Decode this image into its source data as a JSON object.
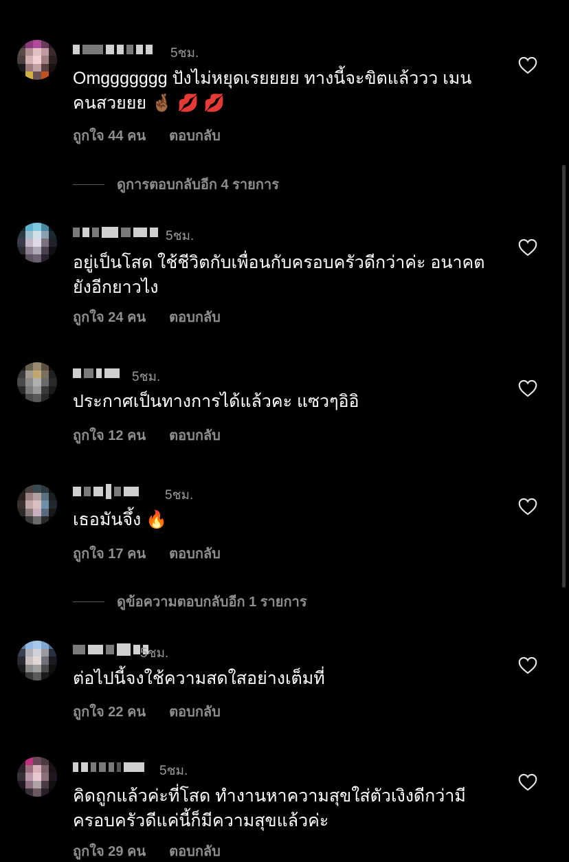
{
  "comments": [
    {
      "time": "5ชม.",
      "text": "Omggggggg ปังไม่หยุดเรยยยย ทางนี้จะขิตแล้ววว เมน คนสวยยย 🤞🏾 💋 💋",
      "likes": "ถูกใจ 44 คน",
      "reply": "ตอบกลับ",
      "view_replies": "ดูการตอบกลับอีก 4 รายการ"
    },
    {
      "time": "5ชม.",
      "text": "อยู่เป็นโสด ใช้ชีวิตกับเพื่อนกับครอบครัวดีกว่าค่ะ อนาคต ยังอีกยาวไง",
      "likes": "ถูกใจ 24 คน",
      "reply": "ตอบกลับ"
    },
    {
      "time": "5ชม.",
      "text": "ประกาศเป็นทางการได้แล้วคะ แซวๆอิอิ",
      "likes": "ถูกใจ 12 คน",
      "reply": "ตอบกลับ"
    },
    {
      "time": "5ชม.",
      "text": "เธอมันจึ้ง 🔥",
      "likes": "ถูกใจ 17 คน",
      "reply": "ตอบกลับ",
      "view_replies": "ดูข้อความตอบกลับอีก 1 รายการ"
    },
    {
      "time": "5ชม.",
      "text": "ต่อไปนี้จงใช้ความสดใสอย่างเต็มที่",
      "likes": "ถูกใจ 22 คน",
      "reply": "ตอบกลับ"
    },
    {
      "time": "5ชม.",
      "text": "คิดถูกแล้วค่ะที่โสด ทำงานหาความสุขใส่ตัวเงิงดีกว่ามี ครอบครัวดีแค่นี้ก็มีความสุขแล้วค่ะ",
      "likes": "ถูกใจ 29 คน",
      "reply": "ตอบกลับ"
    }
  ],
  "icons": {
    "like": "heart-outline-icon",
    "avatar": "pixelated-avatar"
  },
  "colors": {
    "background": "#000000",
    "text": "#ffffff",
    "secondary": "#8e8e8e"
  }
}
